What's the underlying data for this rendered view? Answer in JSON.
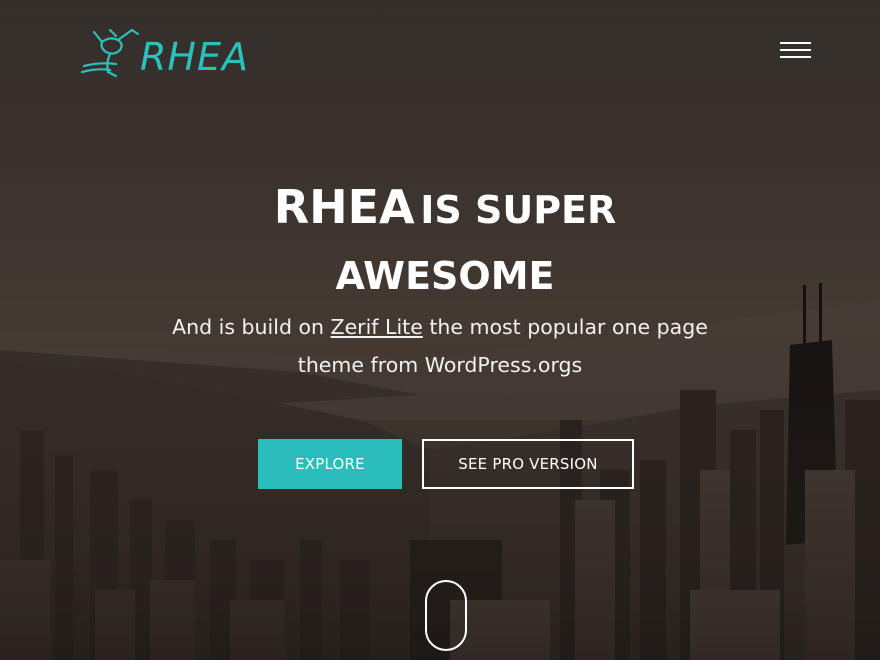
{
  "header": {
    "logo_text": "RHEA",
    "menu_icon": "hamburger-menu-icon"
  },
  "hero": {
    "title_part1": "RHEA",
    "title_part2": "IS SUPER",
    "title_line2": "AWESOME",
    "subtitle_before": "And is build on ",
    "subtitle_link": "Zerif Lite",
    "subtitle_after": " the most popular one page theme from WordPress.orgs",
    "explore_label": "EXPLORE",
    "pro_label": "SEE PRO VERSION"
  },
  "colors": {
    "accent": "#2abdbb",
    "logo": "#2ac1bd",
    "text": "#ffffff"
  }
}
